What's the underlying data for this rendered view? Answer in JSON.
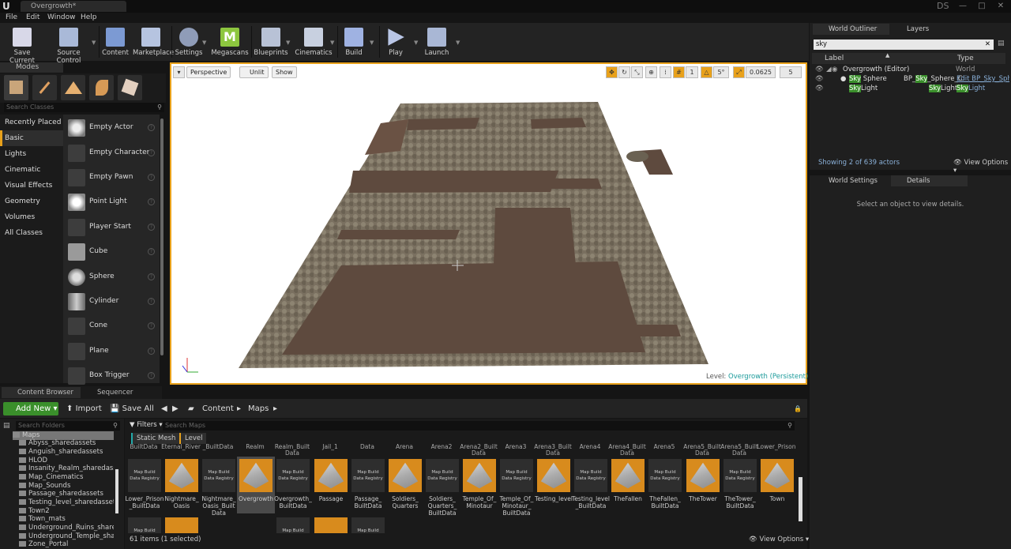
{
  "window": {
    "tab_title": "Overgrowth*",
    "user": "DS"
  },
  "menu": [
    "File",
    "Edit",
    "Window",
    "Help"
  ],
  "toolbar": [
    {
      "label": "Save Current",
      "icon": "save-icon"
    },
    {
      "label": "Source Control",
      "icon": "source-control-icon"
    },
    {
      "label": "Content",
      "icon": "content-icon"
    },
    {
      "label": "Marketplace",
      "icon": "marketplace-icon"
    },
    {
      "label": "Settings",
      "icon": "settings-icon"
    },
    {
      "label": "Megascans",
      "icon": "megascans-icon"
    },
    {
      "label": "Blueprints",
      "icon": "blueprints-icon"
    },
    {
      "label": "Cinematics",
      "icon": "cinematics-icon"
    },
    {
      "label": "Build",
      "icon": "build-icon"
    },
    {
      "label": "Play",
      "icon": "play-icon"
    },
    {
      "label": "Launch",
      "icon": "launch-icon"
    }
  ],
  "modes": {
    "tab": "Modes",
    "search_placeholder": "Search Classes",
    "categories": [
      "Recently Placed",
      "Basic",
      "Lights",
      "Cinematic",
      "Visual Effects",
      "Geometry",
      "Volumes",
      "All Classes"
    ],
    "selected_category": "Basic",
    "items": [
      "Empty Actor",
      "Empty Character",
      "Empty Pawn",
      "Point Light",
      "Player Start",
      "Cube",
      "Sphere",
      "Cylinder",
      "Cone",
      "Plane",
      "Box Trigger"
    ]
  },
  "viewport": {
    "perspective": "Perspective",
    "unlit": "Unlit",
    "show": "Show",
    "grid_snap": "1",
    "rotation_snap": "5°",
    "scale_snap": "0.0625",
    "camera_speed": "5",
    "level_prefix": "Level:",
    "level_name": "Overgrowth (Persistent)"
  },
  "bottom_tabs": [
    "Content Browser",
    "Sequencer"
  ],
  "content_browser": {
    "add_new": "Add New",
    "import": "Import",
    "save_all": "Save All",
    "path": [
      "Content",
      "Maps"
    ],
    "folder_search_placeholder": "Search Folders",
    "folders": [
      "Maps",
      "Abyss_sharedassets",
      "Anguish_sharedassets",
      "HLOD",
      "Insanity_Realm_sharedassets",
      "Map_Cinematics",
      "Map_Sounds",
      "Passage_sharedassets",
      "Testing_level_sharedassets",
      "Town2",
      "Town_mats",
      "Underground_Ruins_sharedassets",
      "Underground_Temple_sharedassets",
      "Zone_Portal"
    ],
    "filters": "Filters",
    "search_placeholder": "Search Maps",
    "filter_tags": [
      "Static Mesh",
      "Level"
    ],
    "top_labels": [
      "BuiltData",
      "Eternal_River",
      "_BuiltData",
      "Realm",
      "Realm_Built Data",
      "Jail_1",
      "Data",
      "Arena",
      "Arena2",
      "Arena2_Built Data",
      "Arena3",
      "Arena3_Built Data",
      "Arena4",
      "Arena4_Built Data",
      "Arena5",
      "Arena5_Built Data",
      "Arena5_Built Data",
      "Lower_Prison"
    ],
    "tile_caption": "Map Build Data Registry",
    "assets": [
      {
        "name": "Lower_Prison _BuiltData",
        "kind": "data"
      },
      {
        "name": "Nightmare_ Oasis",
        "kind": "level"
      },
      {
        "name": "Nightmare_ Oasis_Built Data",
        "kind": "data"
      },
      {
        "name": "Overgrowth",
        "kind": "level"
      },
      {
        "name": "Overgrowth_ BuiltData",
        "kind": "data"
      },
      {
        "name": "Passage",
        "kind": "level"
      },
      {
        "name": "Passage_ BuiltData",
        "kind": "data"
      },
      {
        "name": "Soldiers_ Quarters",
        "kind": "level"
      },
      {
        "name": "Soldiers_ Quarters_ BuiltData",
        "kind": "data"
      },
      {
        "name": "Temple_Of_ Minotaur",
        "kind": "level"
      },
      {
        "name": "Temple_Of_ Minotaur_ BuiltData",
        "kind": "data"
      },
      {
        "name": "Testing_level",
        "kind": "level"
      },
      {
        "name": "Testing_level _BuiltData",
        "kind": "data"
      },
      {
        "name": "TheFallen",
        "kind": "level"
      },
      {
        "name": "TheFallen_ BuiltData",
        "kind": "data"
      },
      {
        "name": "TheTower",
        "kind": "level"
      },
      {
        "name": "TheTower_ BuiltData",
        "kind": "data"
      },
      {
        "name": "Town",
        "kind": "level"
      }
    ],
    "items_count": "61 items (1 selected)",
    "view_options": "View Options"
  },
  "outliner": {
    "tabs": [
      "World Outliner",
      "Layers"
    ],
    "search_value": "sky",
    "col_label": "Label",
    "col_type": "Type",
    "root": {
      "label": "Overgrowth (Editor)",
      "type": "World"
    },
    "rows": [
      {
        "pre": "",
        "hl": "Sky",
        "post": " Sphere",
        "type_pre": "BP_",
        "type_hl": "Sky",
        "type_post": "_Sphere_C",
        "link": "Edit BP_Sky_Sphere"
      },
      {
        "pre": "",
        "hl": "Sky",
        "post": "Light",
        "type_pre": "",
        "type_hl": "Sky",
        "type_post": "Light",
        "link_hl": "Sky",
        "link_post": "Light"
      }
    ],
    "showing": "Showing 2 of 639 actors",
    "view_options": "View Options"
  },
  "details": {
    "tabs": [
      "World Settings",
      "Details"
    ],
    "message": "Select an object to view details."
  },
  "colors": {
    "accent": "#e8a11b",
    "green": "#3a8f2b",
    "link": "#8ab0d8"
  }
}
